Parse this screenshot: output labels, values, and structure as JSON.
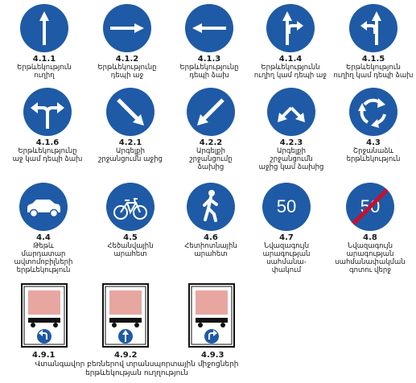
{
  "colors": {
    "blue": "#1f5aa6",
    "red": "#c8102e",
    "white": "#ffffff",
    "black": "#111111",
    "truck": "#e8a6a0"
  },
  "signs": [
    {
      "code": "4.1.1",
      "caption": "Երթևեկություն\nուղիղ",
      "icon": "arrow-up-icon"
    },
    {
      "code": "4.1.2",
      "caption": "Երթևեկությունը\nդեպի աջ",
      "icon": "arrow-right-icon"
    },
    {
      "code": "4.1.3",
      "caption": "Երթևեկությունը\nդեպի ձախ",
      "icon": "arrow-left-icon"
    },
    {
      "code": "4.1.4",
      "caption": "Երթևեկությունն\nուղիղ կամ դեպի աջ",
      "icon": "arrow-up-right-icon"
    },
    {
      "code": "4.1.5",
      "caption": "Երթևեկություն\nուղիղ կամ դեպի ձախ",
      "icon": "arrow-up-left-icon"
    },
    {
      "code": "4.1.6",
      "caption": "Երթևեկությունը\nաջ կամ դեպի ձախ",
      "icon": "arrow-left-right-icon"
    },
    {
      "code": "4.2.1",
      "caption": "Արգելքի\nշրջանցումն աջից",
      "icon": "arrow-down-right-icon"
    },
    {
      "code": "4.2.2",
      "caption": "Արգելքի\nշրջանցումը\nձախից",
      "icon": "arrow-down-left-icon"
    },
    {
      "code": "4.2.3",
      "caption": "Արգելքի\nշրջանցումն\nաջից կամ ձախից",
      "icon": "arrows-down-both-icon"
    },
    {
      "code": "4.3",
      "caption": "Շրջանաձև\nերթևեկություն",
      "icon": "roundabout-icon"
    },
    {
      "code": "4.4",
      "caption": "Թեթև\nմարդատար\nավտոմոբիլների\nերթևեկություն",
      "icon": "car-icon"
    },
    {
      "code": "4.5",
      "caption": "Հեծանվային\nարահետ",
      "icon": "bicycle-icon"
    },
    {
      "code": "4.6",
      "caption": "Հետիոտնային\nարահետ",
      "icon": "pedestrian-icon"
    },
    {
      "code": "4.7",
      "caption": "Նվազագույն\nարագության\nսահմանա-\nփակում",
      "icon": "min-speed-icon",
      "value": "50"
    },
    {
      "code": "4.8",
      "caption": "Նվազագույն\nարագության\nսահմանափակման\nգոտու վերջ",
      "icon": "min-speed-end-icon",
      "value": "50"
    }
  ],
  "plates": [
    {
      "code": "4.9.1",
      "icon": "truck-arrow-left-icon"
    },
    {
      "code": "4.9.2",
      "icon": "truck-arrow-up-icon"
    },
    {
      "code": "4.9.3",
      "icon": "truck-arrow-right-icon"
    }
  ],
  "plates_caption": "Վտանգավոր բեռներով տրանսպորտային միջոցների\nերթևեկության ուղղություն"
}
